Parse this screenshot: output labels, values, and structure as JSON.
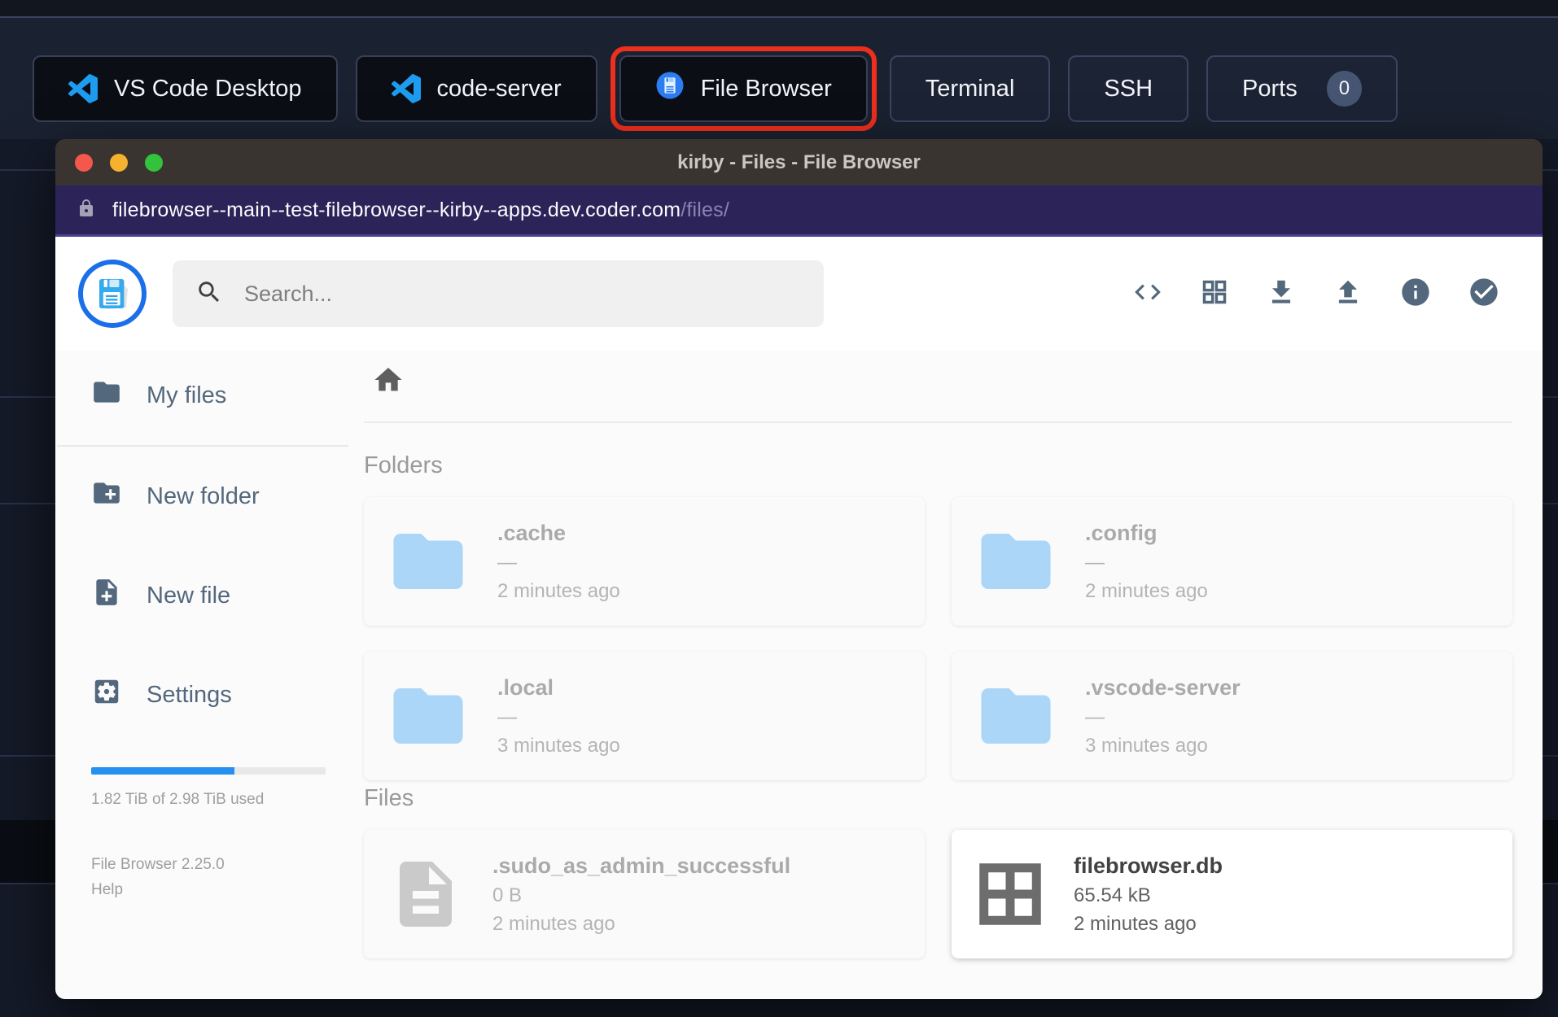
{
  "topbar": {
    "apps": [
      {
        "label": "VS Code Desktop"
      },
      {
        "label": "code-server"
      },
      {
        "label": "File Browser",
        "highlighted": true
      }
    ],
    "actions": [
      {
        "label": "Terminal"
      },
      {
        "label": "SSH"
      },
      {
        "label": "Ports",
        "badge": "0"
      }
    ]
  },
  "window": {
    "title": "kirby - Files - File Browser",
    "url_host": "filebrowser--main--test-filebrowser--kirby--apps.dev.coder.com",
    "url_path": "/files/"
  },
  "header": {
    "search_placeholder": "Search...",
    "toolbar_icons": [
      "code-icon",
      "grid-view-icon",
      "download-icon",
      "upload-icon",
      "info-icon",
      "check-circle-icon"
    ]
  },
  "sidebar": {
    "items": [
      {
        "label": "My files",
        "icon": "folder-icon"
      },
      {
        "label": "New folder",
        "icon": "new-folder-icon"
      },
      {
        "label": "New file",
        "icon": "new-file-icon"
      },
      {
        "label": "Settings",
        "icon": "settings-icon"
      }
    ],
    "usage_text": "1.82 TiB of 2.98 TiB used",
    "usage_percent": 61,
    "version": "File Browser 2.25.0",
    "help_label": "Help"
  },
  "listing": {
    "sections": [
      {
        "title": "Folders",
        "items": [
          {
            "name": ".cache",
            "size": "—",
            "modified": "2 minutes ago",
            "hidden": true
          },
          {
            "name": ".config",
            "size": "—",
            "modified": "2 minutes ago",
            "hidden": true
          },
          {
            "name": ".local",
            "size": "—",
            "modified": "3 minutes ago",
            "hidden": true
          },
          {
            "name": ".vscode-server",
            "size": "—",
            "modified": "3 minutes ago",
            "hidden": true
          }
        ]
      },
      {
        "title": "Files",
        "items": [
          {
            "name": ".sudo_as_admin_successful",
            "size": "0 B",
            "modified": "2 minutes ago",
            "hidden": true
          },
          {
            "name": "filebrowser.db",
            "size": "65.54 kB",
            "modified": "2 minutes ago",
            "hidden": false
          }
        ]
      }
    ]
  },
  "colors": {
    "accent_blue": "#2490EF",
    "folder_icon_blue": "#64B5F6",
    "highlight_ring_red": "#ED2F1D",
    "url_bar_purple": "#2C2358",
    "title_bar_brown": "#3A3431",
    "sidebar_slate": "#53687C"
  }
}
